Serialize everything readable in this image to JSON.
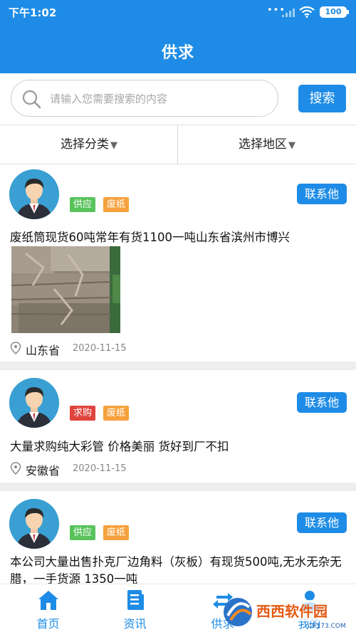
{
  "status_bar": {
    "time": "下午1:02",
    "battery": "100"
  },
  "header": {
    "title": "供求"
  },
  "search": {
    "placeholder": "请输入您需要搜索的内容",
    "button_label": "搜索"
  },
  "filters": {
    "category": "选择分类",
    "region": "选择地区"
  },
  "posts": [
    {
      "type_tag": "供应",
      "category_tag": "废纸",
      "contact_label": "联系他",
      "title": "废纸筒现货60吨常年有货1100一吨山东省滨州市博兴",
      "location": "山东省",
      "date": "2020-11-15"
    },
    {
      "type_tag": "求购",
      "category_tag": "废纸",
      "contact_label": "联系他",
      "title": "大量求购纯大彩管 价格美丽  货好到厂不扣",
      "location": "安徽省",
      "date": "2020-11-15"
    },
    {
      "type_tag": "供应",
      "category_tag": "废纸",
      "contact_label": "联系他",
      "title": "本公司大量出售扑克厂边角料（灰板）有现货500吨,无水无杂无腊，一手货源 1350一吨"
    }
  ],
  "tabs": [
    {
      "label": "首页",
      "icon": "home-icon"
    },
    {
      "label": "资讯",
      "icon": "news-icon"
    },
    {
      "label": "供求",
      "icon": "supply-demand-icon"
    },
    {
      "label": "我的",
      "icon": "profile-icon"
    }
  ],
  "watermark": {
    "text": "西西软件园",
    "site": "CR173.COM"
  },
  "colors": {
    "primary": "#1e8ce6",
    "supply_tag": "#58c35a",
    "demand_tag": "#e0443e",
    "category_tag": "#f6a13d"
  }
}
